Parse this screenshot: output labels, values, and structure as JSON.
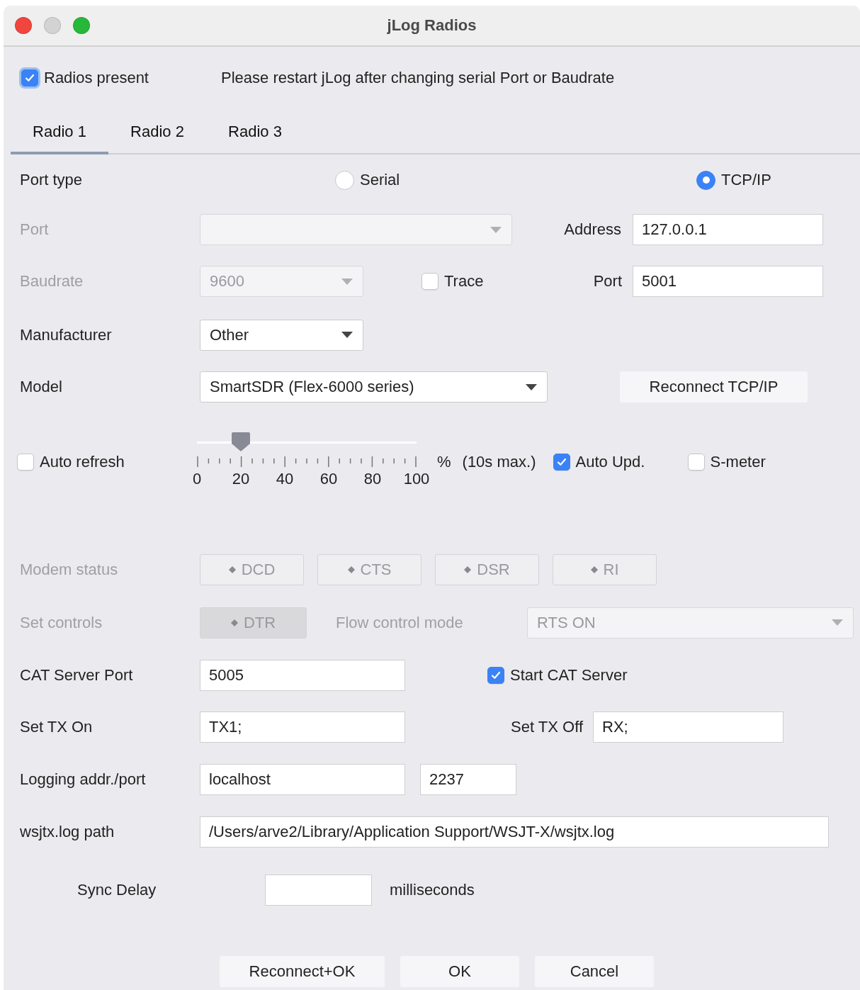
{
  "window": {
    "title": "jLog Radios"
  },
  "radios_present": {
    "label": "Radios present",
    "checked": true
  },
  "notice": "Please restart jLog after changing serial Port or Baudrate",
  "tabs": [
    {
      "label": "Radio 1",
      "selected": true
    },
    {
      "label": "Radio 2",
      "selected": false
    },
    {
      "label": "Radio 3",
      "selected": false
    }
  ],
  "port_type": {
    "label": "Port type",
    "options": [
      {
        "label": "Serial",
        "selected": false
      },
      {
        "label": "TCP/IP",
        "selected": true
      }
    ]
  },
  "port": {
    "label": "Port",
    "disabled": true
  },
  "address": {
    "label": "Address",
    "value": "127.0.0.1"
  },
  "baudrate": {
    "label": "Baudrate",
    "value": "9600",
    "disabled": true
  },
  "trace": {
    "label": "Trace",
    "checked": false
  },
  "tcp_port": {
    "label": "Port",
    "value": "5001"
  },
  "manufacturer": {
    "label": "Manufacturer",
    "value": "Other",
    "disabled": false
  },
  "model": {
    "label": "Model",
    "value": "SmartSDR (Flex-6000 series)",
    "disabled": false
  },
  "reconnect_button": "Reconnect TCP/IP",
  "auto_refresh": {
    "label": "Auto refresh",
    "checked": false
  },
  "refresh_slider": {
    "level": 0.2,
    "tick_labels": [
      "0",
      "20",
      "40",
      "60",
      "80",
      "100"
    ],
    "unit": "%",
    "note": "(10s max.)"
  },
  "auto_update": {
    "label": "Auto Upd.",
    "checked": true
  },
  "s_meter": {
    "label": "S-meter",
    "checked": false
  },
  "modem_status": {
    "label": "Modem status",
    "disabled": true,
    "indicators": [
      "DCD",
      "CTS",
      "DSR",
      "RI"
    ]
  },
  "set_controls": {
    "label": "Set controls",
    "disabled": true,
    "dtr": {
      "label": "DTR",
      "pressed": true
    }
  },
  "flow_control": {
    "label": "Flow control mode",
    "value": "RTS ON",
    "disabled": true
  },
  "cat_server_port": {
    "label": "CAT Server Port",
    "value": "5005"
  },
  "start_cat_server": {
    "label": "Start CAT Server",
    "checked": true
  },
  "set_tx_on": {
    "label": "Set TX On",
    "value": "TX1;"
  },
  "set_tx_off": {
    "label": "Set TX Off",
    "value": "RX;"
  },
  "logging": {
    "label": "Logging addr./port",
    "address": "localhost",
    "port": "2237"
  },
  "wsjtx_log_path": {
    "label": "wsjtx.log path",
    "value": "/Users/arve2/Library/Application Support/WSJT-X/wsjtx.log"
  },
  "sync_delay": {
    "label": "Sync Delay",
    "unit": "milliseconds"
  },
  "buttons": [
    "Reconnect+OK",
    "OK",
    "Cancel"
  ]
}
